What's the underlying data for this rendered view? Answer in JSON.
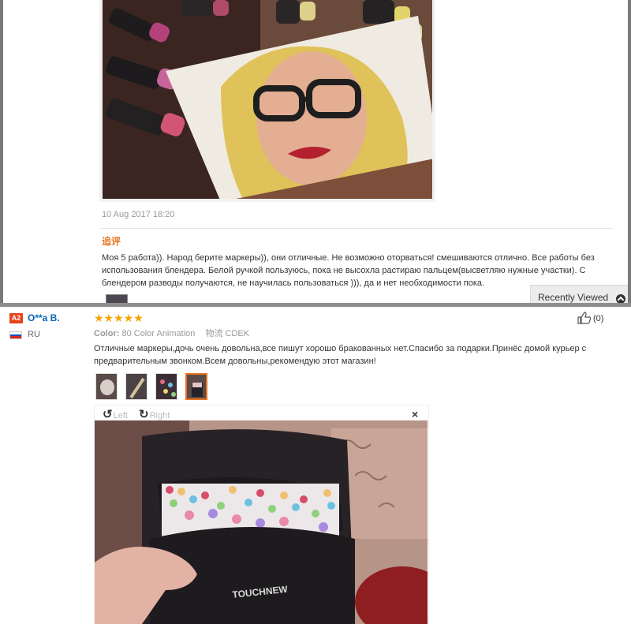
{
  "previous_review": {
    "photo_description": "",
    "date": "10 Aug 2017 18:20",
    "additional_feedback_label": "追评",
    "additional_feedback_text": "Моя 5 работа)). Народ берите маркеры)), они отличные. Не возможно оторваться! смешиваются отлично. Все работы без использования блендера. Белой ручкой пользуюсь, пока не высохла растираю пальцем(высветляю нужные участки). С блендером разводы получаются, не научилась пользоваться ))), да и нет необходимости пока."
  },
  "recently_viewed": {
    "label": "Recently Viewed",
    "icon": "chevron-up-icon"
  },
  "review": {
    "badge": "A2",
    "user_name": "O**a B.",
    "country_code": "RU",
    "flag_colors": [
      "#ffffff",
      "#1c4fb3",
      "#d52b1e"
    ],
    "stars": "★★★★★",
    "star_color": "#f7a400",
    "color_label": "Color:",
    "color_value": "80 Color Animation",
    "shipping_label": "物流",
    "shipping_value": "CDEK",
    "helpful_count": "(0)",
    "text": "Отличные маркеры,дочь очень довольна,все пишут хорошо бракованных нет.Спасибо за подарки.Принёс домой курьер с предварительным звонком.Всем довольны,рекомендую этот магазин!",
    "thumbnails": [
      {
        "name": "thumbnail-1"
      },
      {
        "name": "thumbnail-2"
      },
      {
        "name": "thumbnail-3"
      },
      {
        "name": "thumbnail-4",
        "active": true
      }
    ]
  },
  "viewer": {
    "rotate_left_label": "Left",
    "rotate_right_label": "Right",
    "close_label": "×"
  },
  "colors": {
    "accent_orange": "#e5711e",
    "link_blue": "#0a63b4",
    "badge_red": "#e5431a"
  }
}
